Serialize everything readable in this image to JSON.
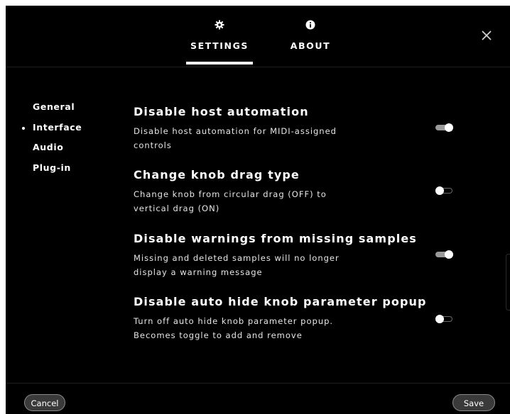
{
  "tabs": {
    "settings": {
      "label": "SETTINGS",
      "icon": "gear-icon",
      "active": true
    },
    "about": {
      "label": "ABOUT",
      "icon": "info-icon",
      "active": false
    }
  },
  "close": {
    "icon": "close-icon"
  },
  "sidebar": {
    "items": [
      {
        "label": "General",
        "active": false
      },
      {
        "label": "Interface",
        "active": true
      },
      {
        "label": "Audio",
        "active": false
      },
      {
        "label": "Plug-in",
        "active": false
      }
    ]
  },
  "settings": [
    {
      "title": "Disable host automation",
      "desc_lines": [
        "Disable host automation for MIDI-assigned",
        "controls"
      ],
      "enabled": true
    },
    {
      "title": "Change knob drag type",
      "desc_lines": [
        "Change knob from circular drag (OFF) to",
        "vertical drag (ON)"
      ],
      "enabled": false
    },
    {
      "title": "Disable warnings from missing samples",
      "desc_lines": [
        "Missing and deleted samples will no longer",
        "display a warning message"
      ],
      "enabled": true
    },
    {
      "title": "Disable auto hide knob parameter popup",
      "desc_lines": [
        "Turn off auto hide knob parameter popup.",
        "Becomes toggle to add and remove"
      ],
      "enabled": false
    }
  ],
  "footer": {
    "cancel_label": "Cancel",
    "save_label": "Save"
  },
  "colors": {
    "background": "#000000",
    "text": "#ffffff",
    "toggle_on": "#9a9a9a",
    "button_bg": "#3a3a3a"
  }
}
